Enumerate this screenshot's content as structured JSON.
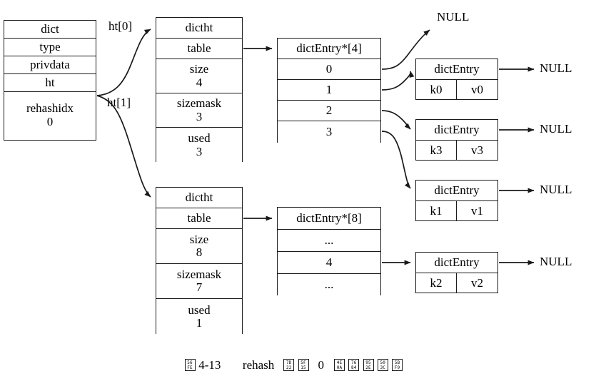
{
  "diagram": {
    "title_caption": {
      "figure_label": "图 4-13",
      "figure_number": "4-13",
      "prefix_cjk": [
        "56FE"
      ],
      "mid_text": "rehash",
      "mid_cjk": [
        "7D22",
        "5F15"
      ],
      "index_value": "0",
      "suffix_cjk": [
        "4E0A",
        "7684",
        "952E",
        "503C",
        "5BF9"
      ],
      "full_text": "图 4-13    rehash 索引 0 上的键值对"
    },
    "dict_struct": {
      "name": "dict",
      "fields": [
        {
          "label": "dict",
          "value": ""
        },
        {
          "label": "type",
          "value": ""
        },
        {
          "label": "privdata",
          "value": ""
        },
        {
          "label": "ht",
          "value": ""
        },
        {
          "label": "rehashidx",
          "value": "0"
        }
      ]
    },
    "ht_edge_labels": {
      "ht0": "ht[0]",
      "ht1": "ht[1]"
    },
    "dictht_0": {
      "name": "dictht",
      "fields": [
        {
          "label": "dictht",
          "value": ""
        },
        {
          "label": "table",
          "value": ""
        },
        {
          "label": "size",
          "value": "4"
        },
        {
          "label": "sizemask",
          "value": "3"
        },
        {
          "label": "used",
          "value": "3"
        }
      ]
    },
    "dictht_1": {
      "name": "dictht",
      "fields": [
        {
          "label": "dictht",
          "value": ""
        },
        {
          "label": "table",
          "value": ""
        },
        {
          "label": "size",
          "value": "8"
        },
        {
          "label": "sizemask",
          "value": "7"
        },
        {
          "label": "used",
          "value": "1"
        }
      ]
    },
    "table_0": {
      "header": "dictEntry*[4]",
      "slots": [
        "0",
        "1",
        "2",
        "3"
      ]
    },
    "table_1": {
      "header": "dictEntry*[8]",
      "slots": [
        "...",
        "4",
        "..."
      ]
    },
    "entries": [
      {
        "header": "dictEntry",
        "key": "k0",
        "value": "v0",
        "next": "NULL"
      },
      {
        "header": "dictEntry",
        "key": "k3",
        "value": "v3",
        "next": "NULL"
      },
      {
        "header": "dictEntry",
        "key": "k1",
        "value": "v1",
        "next": "NULL"
      },
      {
        "header": "dictEntry",
        "key": "k2",
        "value": "v2",
        "next": "NULL"
      }
    ],
    "null_labels": {
      "top": "NULL",
      "entry0_next": "NULL",
      "entry1_next": "NULL",
      "entry2_next": "NULL",
      "entry3_next": "NULL"
    },
    "colors": {
      "stroke": "#1a1a1a",
      "background": "#ffffff",
      "text": "#000000"
    }
  }
}
